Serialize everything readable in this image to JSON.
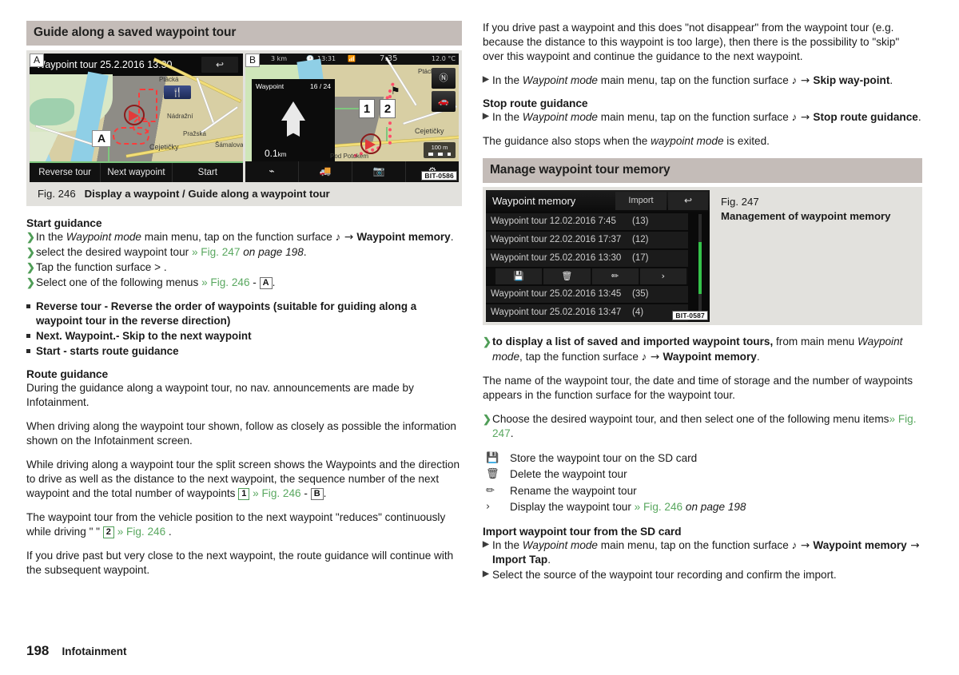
{
  "left": {
    "section_title": "Guide along a saved waypoint tour",
    "fig246": {
      "tag_a": "A",
      "tag_b": "B",
      "tag_a_inner": "A",
      "bitcode": "BIT-0586",
      "screen_a": {
        "title": "Waypoint tour 25.2.2016 13:30",
        "back_icon": "↩",
        "poi_icon": "🍴",
        "buttons": [
          "Reverse tour",
          "Next waypoint",
          "Start"
        ],
        "map_labels": [
          "Ptácká",
          "Nádražní",
          "Pražská",
          "Cejetičky",
          "Šámalova"
        ]
      },
      "screen_b": {
        "status_scale": "3 km",
        "status_clock_icon": "🕐",
        "status_time": "13:31",
        "status_wifi_icon": "📶",
        "status_eta": "7:35",
        "status_temp": "12.0 °C",
        "panel_label": "Waypoint",
        "panel_count": "16 / 24",
        "panel_distance": "0.1",
        "panel_distance_unit": "km",
        "callout_1": "1",
        "callout_2": "2",
        "compass_icon": "Ⓝ",
        "view_icon": "🚗",
        "scale_value": "100 m",
        "map_labels": [
          "Ptácká",
          "Cejetičky",
          "Pod Potokem"
        ],
        "toolbar_icons": [
          "route-icon",
          "traffic-icon",
          "camera-icon",
          "settings-icon"
        ]
      },
      "caption_number": "Fig. 246",
      "caption_text": "Display a waypoint / Guide along a waypoint tour"
    },
    "start_guidance": {
      "heading": "Start guidance",
      "steps": [
        {
          "pre": "In the ",
          "italic": "Waypoint mode",
          "mid": " main menu, tap on the function surface ",
          "icon": "♪",
          "arrow": " → ",
          "bold": "Waypoint memory",
          "post": "."
        },
        {
          "pre": "select the desired waypoint tour ",
          "ref": "» Fig. 247",
          "italic2": " on page 198",
          "post": "."
        },
        {
          "pre": "Tap the function surface > ."
        },
        {
          "pre": "Select one of the following menus ",
          "ref": "» Fig. 246",
          "dash": " - ",
          "callout": "A",
          "post": "."
        }
      ],
      "bullets": [
        "Reverse tour - Reverse the order of waypoints (suitable for guiding along a waypoint tour in the reverse direction)",
        "Next. Waypoint.- Skip to the next waypoint",
        "Start - starts route guidance"
      ]
    },
    "route_guidance": {
      "heading": "Route guidance",
      "p1": "During the guidance along a waypoint tour, no nav. announcements are made by Infotainment.",
      "p2": "When driving along the waypoint tour shown, follow as closely as possible the information shown on the Infotainment screen.",
      "p3_a": "While driving along a waypoint tour the split screen shows the Waypoints and the direction to drive as well as the distance to the next waypoint, the sequence number of the next waypoint and the total number of waypoints ",
      "p3_callout": "1",
      "p3_ref": "» Fig. 246",
      "p3_dash": " - ",
      "p3_callout2": "B",
      "p3_end": ".",
      "p4_a": "The waypoint tour from the vehicle position to the next waypoint \"reduces\" continuously while driving \" \" ",
      "p4_callout": "2",
      "p4_ref": "» Fig. 246",
      "p4_end": " .",
      "p5": "If you drive past but very close to the next waypoint, the route guidance will continue with the subsequent waypoint."
    }
  },
  "right": {
    "intro": "If you drive past a waypoint and this does \"not disappear\" from the waypoint tour (e.g. because the distance to this waypoint is too large), then there is the possibility to \"skip\" over this waypoint and continue the guidance to the next waypoint.",
    "skip_step": {
      "pre": "In the ",
      "italic": "Waypoint mode",
      "mid": " main menu, tap on the function surface ",
      "icon": "♪",
      "arrow": " → ",
      "bold": "Skip way-point",
      "post": "."
    },
    "stop_guidance": {
      "heading": "Stop route guidance",
      "step": {
        "pre": "In the ",
        "italic": "Waypoint mode",
        "mid": " main menu, tap on the function surface ",
        "icon": "♪",
        "arrow": " → ",
        "bold": "Stop route guidance",
        "post": "."
      },
      "note_a": "The guidance also stops when the ",
      "note_italic": "waypoint mode",
      "note_b": " is exited."
    },
    "section_title": "Manage waypoint tour memory",
    "fig247": {
      "bitcode": "BIT-0587",
      "screen": {
        "title": "Waypoint memory",
        "import_label": "Import",
        "back_icon": "↩",
        "rows": [
          {
            "name": "Waypoint tour 12.02.2016 7:45",
            "count": "(13)"
          },
          {
            "name": "Waypoint tour 22.02.2016 17:37",
            "count": "(12)"
          },
          {
            "name": "Waypoint tour 25.02.2016 13:30",
            "count": "(17)"
          }
        ],
        "actions": [
          "💾",
          "🗑",
          "✏",
          "›"
        ],
        "rows_after": [
          {
            "name": "Waypoint tour 25.02.2016 13:45",
            "count": "(35)"
          },
          {
            "name": "Waypoint tour 25.02.2016 13:47",
            "count": "(4)"
          }
        ]
      },
      "caption_number": "Fig. 247",
      "caption_text": "Management of waypoint memory"
    },
    "display_step": {
      "bold": "to display a list of saved and imported waypoint tours,",
      "mid": " from main menu ",
      "italic": "Waypoint mode",
      "mid2": ", tap the function surface ",
      "icon": "♪",
      "arrow": " → ",
      "bold2": "Waypoint memory",
      "post": "."
    },
    "name_para": "The name of the waypoint tour, the date and time of storage and the number of waypoints appears in the function surface for the waypoint tour.",
    "choose_step": {
      "pre": "Choose the desired waypoint tour, and then select one of the following menu items",
      "ref": "» Fig. 247",
      "post": "."
    },
    "menu_items": [
      {
        "icon": "💾",
        "icon_name": "save-icon",
        "label": "Store the waypoint tour on the SD card"
      },
      {
        "icon": "🗑",
        "icon_name": "trash-icon",
        "label": "Delete the waypoint tour"
      },
      {
        "icon": "✏",
        "icon_name": "pencil-icon",
        "label": "Rename the waypoint tour"
      },
      {
        "icon": "›",
        "icon_name": "chevron-right-icon",
        "label": "Display the waypoint tour ",
        "ref": "» Fig. 246",
        "italic": " on page 198"
      }
    ],
    "import": {
      "heading": "Import waypoint tour from the SD card",
      "step1": {
        "pre": "In the ",
        "italic": "Waypoint mode",
        "mid": " main menu, tap on the function surface ",
        "icon": "♪",
        "arrow": " → ",
        "bold": "Waypoint memory",
        "arrow2": " → ",
        "bold2": "Import Tap",
        "post": "."
      },
      "step2": "Select the source of the waypoint tour recording and confirm the import."
    }
  },
  "footer": {
    "page": "198",
    "chapter": "Infotainment"
  },
  "colors": {
    "accent_green": "#5aa860",
    "header_bg": "#c4bcb8",
    "figure_bg": "#e2e1dd"
  }
}
